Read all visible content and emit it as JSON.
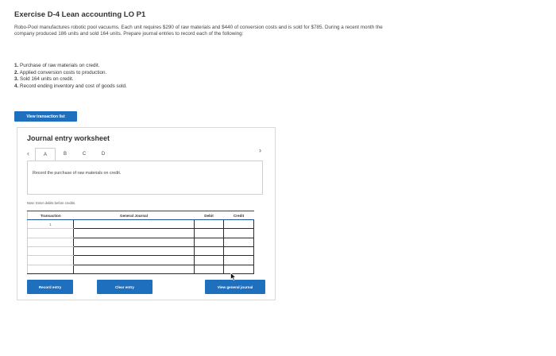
{
  "page": {
    "title": "Exercise D-4 Lean accounting LO P1",
    "problem_text": "Robo-Pool manufactures robotic pool vacuums. Each unit requires $290 of raw materials and $440 of conversion costs and is sold for $785. During a recent month the company produced 186 units and sold 164 units. Prepare journal entries to record each of the following:",
    "steps": [
      {
        "num": "1.",
        "text": "Purchase of raw materials on credit."
      },
      {
        "num": "2.",
        "text": "Applied conversion costs to production."
      },
      {
        "num": "3.",
        "text": "Sold 164 units on credit."
      },
      {
        "num": "4.",
        "text": "Record ending inventory and cost of goods sold."
      }
    ],
    "view_transaction_button": "View transaction list"
  },
  "worksheet": {
    "title": "Journal entry worksheet",
    "tabs": [
      "A",
      "B",
      "C",
      "D"
    ],
    "active_tab": "A",
    "instruction": "Record the purchase of raw materials on credit.",
    "note": "Note: Enter debits before credits.",
    "table": {
      "headers": {
        "transaction": "Transaction",
        "account": "General Journal",
        "debit": "Debit",
        "credit": "Credit"
      },
      "rows": [
        {
          "transaction": "1",
          "account": "",
          "debit": "",
          "credit": ""
        },
        {
          "transaction": "",
          "account": "",
          "debit": "",
          "credit": ""
        },
        {
          "transaction": "",
          "account": "",
          "debit": "",
          "credit": ""
        },
        {
          "transaction": "",
          "account": "",
          "debit": "",
          "credit": ""
        },
        {
          "transaction": "",
          "account": "",
          "debit": "",
          "credit": ""
        },
        {
          "transaction": "",
          "account": "",
          "debit": "",
          "credit": ""
        }
      ]
    },
    "buttons": {
      "record": "Record entry",
      "clear": "Clear entry",
      "view_journal": "View general journal"
    }
  },
  "colors": {
    "accent": "#1f6fbf"
  },
  "icons": {
    "prev": "chevron-left-icon",
    "next": "chevron-right-icon",
    "cursor": "mouse-pointer-icon"
  }
}
